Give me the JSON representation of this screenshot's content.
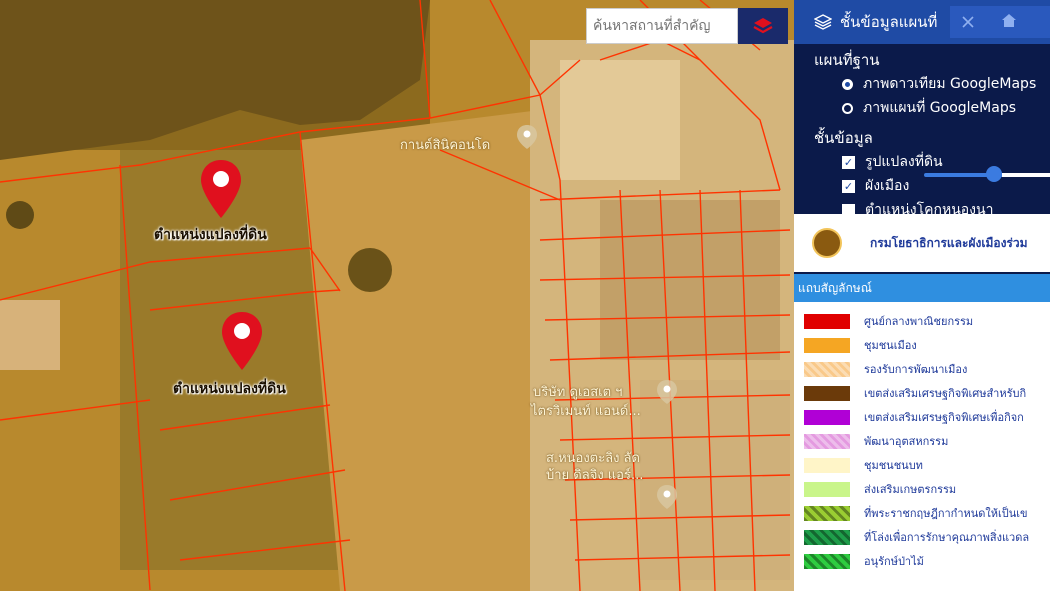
{
  "map": {
    "search_placeholder": "ค้นหาสถานที่สำคัญ",
    "pins": [
      {
        "label": "ตำแหน่งแปลงที่ดิน"
      },
      {
        "label": "ตำแหน่งแปลงที่ดิน"
      }
    ],
    "pois": [
      {
        "label": "กานต์สินิคอนโด"
      },
      {
        "label": "บริษัท ดูเอสเต ฯ"
      },
      {
        "label": "ไตรวิเมนท์ แอนด์..."
      },
      {
        "label": "ส.หนองตะลิง ลัด"
      },
      {
        "label": "บ้าย ดิลจิง แอร์..."
      }
    ],
    "overlay_color": "#c9932e",
    "parcel_line_color": "#ff3300"
  },
  "panel": {
    "title": "ชั้นข้อมูลแผนที่",
    "basemap_heading": "แผนที่ฐาน",
    "basemap_options": [
      {
        "label": "ภาพดาวเทียม GoogleMaps",
        "selected": true
      },
      {
        "label": "ภาพแผนที่ GoogleMaps",
        "selected": false
      }
    ],
    "layers_heading": "ชั้นข้อมูล",
    "layers": [
      {
        "label": "รูปแปลงที่ดิน",
        "checked": true
      },
      {
        "label": "ผังเมือง",
        "checked": true
      },
      {
        "label": "ตำแหน่งโคกหนองนา",
        "checked": false
      }
    ],
    "opacity_slider_value": 0.55,
    "department": "กรมโยธาธิการและผังเมืองร่วม",
    "legend_heading": "แถบสัญลักษณ์",
    "legend": [
      {
        "label": "ศูนย์กลางพาณิชยกรรม",
        "color": "#e00000"
      },
      {
        "label": "ชุมชนเมือง",
        "color": "#f5a623"
      },
      {
        "label": "รองรับการพัฒนาเมือง",
        "color": "#f9c98a"
      },
      {
        "label": "เขตส่งเสริมเศรษฐกิจพิเศษสำหรับกิ",
        "color": "#6b3a0a"
      },
      {
        "label": "เขตส่งเสริมเศรษฐกิจพิเศษเพื่อกิจก",
        "color": "#b000d6"
      },
      {
        "label": "พัฒนาอุตสหกรรม",
        "color": "#e49ae0"
      },
      {
        "label": "ชุมชนชนบท",
        "color": "#fff5c8"
      },
      {
        "label": "ส่งเสริมเกษตรกรรม",
        "color": "#c9f58a"
      },
      {
        "label": "ที่พระราชกฤษฎีกากำหนดให้เป็นเข",
        "color": "#9acd32"
      },
      {
        "label": "ที่โล่งเพื่อการรักษาคุณภาพสิ่งแวดล",
        "color": "#1e9e4a"
      },
      {
        "label": "อนุรักษ์ป่าไม้",
        "color": "#2ecc40"
      }
    ]
  }
}
